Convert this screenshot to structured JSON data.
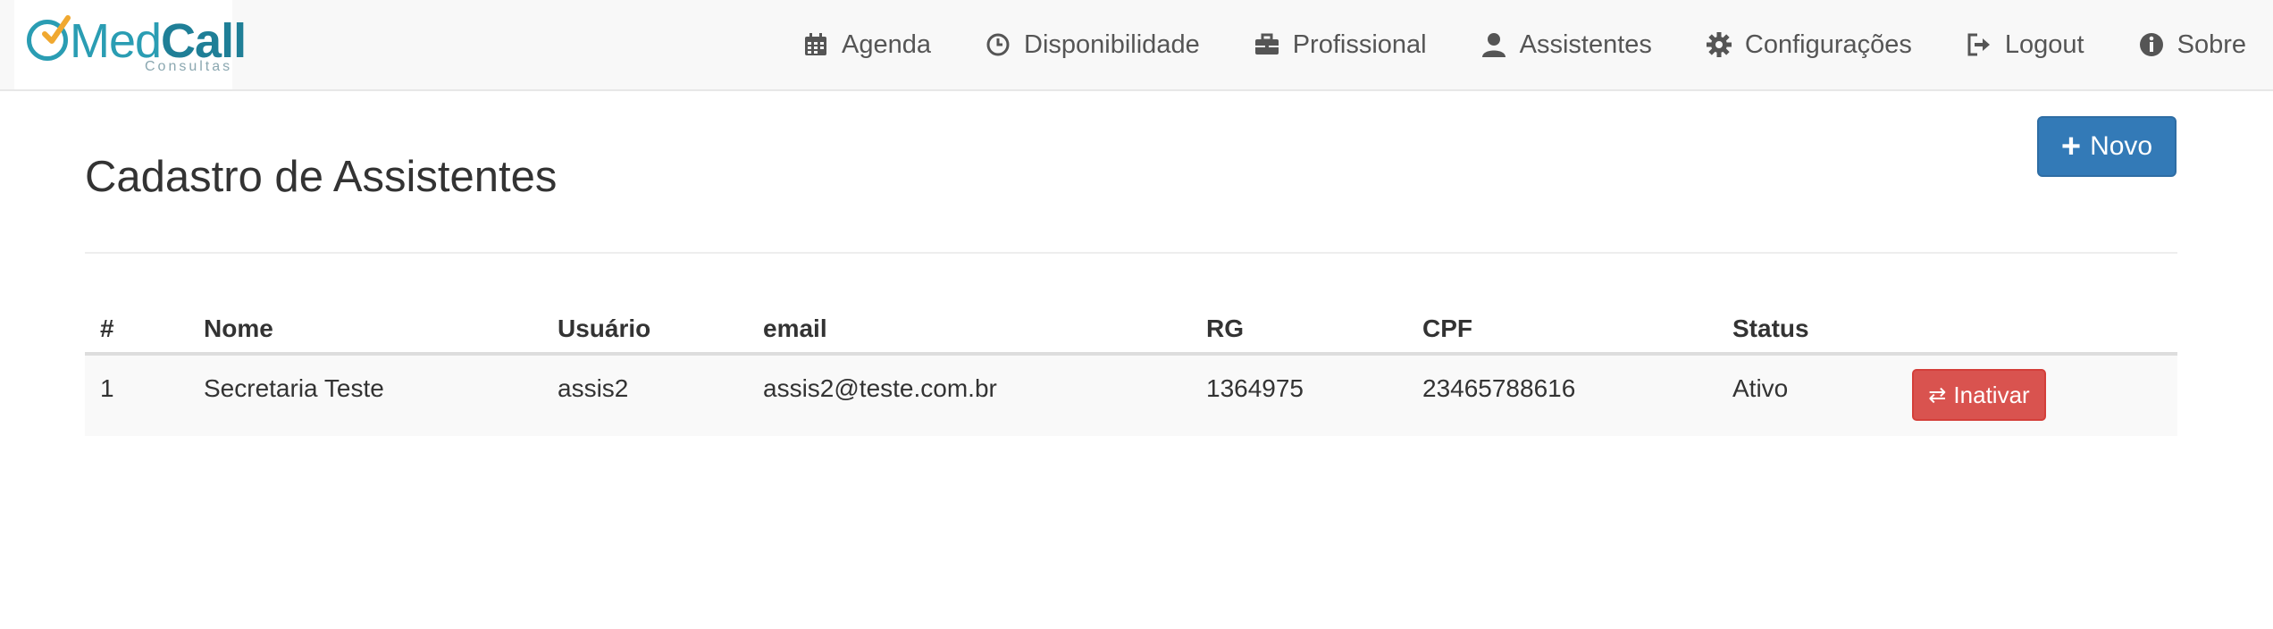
{
  "brand": {
    "name_part1": "Med",
    "name_part2": "Call",
    "subtitle": "Consultas",
    "colors": {
      "primary": "#2a9db3",
      "check": "#f0a830"
    }
  },
  "nav": {
    "items": [
      {
        "label": "Agenda",
        "icon": "calendar-icon"
      },
      {
        "label": "Disponibilidade",
        "icon": "clock-icon"
      },
      {
        "label": "Profissional",
        "icon": "briefcase-icon"
      },
      {
        "label": "Assistentes",
        "icon": "user-icon"
      },
      {
        "label": "Configurações",
        "icon": "gear-icon"
      },
      {
        "label": "Logout",
        "icon": "logout-icon"
      },
      {
        "label": "Sobre",
        "icon": "info-icon"
      }
    ]
  },
  "page": {
    "title": "Cadastro de Assistentes",
    "new_button_label": "Novo",
    "new_button_color": "#337ab7"
  },
  "table": {
    "headers": [
      "#",
      "Nome",
      "Usuário",
      "email",
      "RG",
      "CPF",
      "Status",
      ""
    ],
    "rows": [
      {
        "id": "1",
        "nome": "Secretaria Teste",
        "usuario": "assis2",
        "email": "assis2@teste.com.br",
        "rg": "1364975",
        "cpf": "23465788616",
        "status": "Ativo",
        "action_label": "Inativar",
        "action_color": "#d9534f"
      }
    ]
  }
}
